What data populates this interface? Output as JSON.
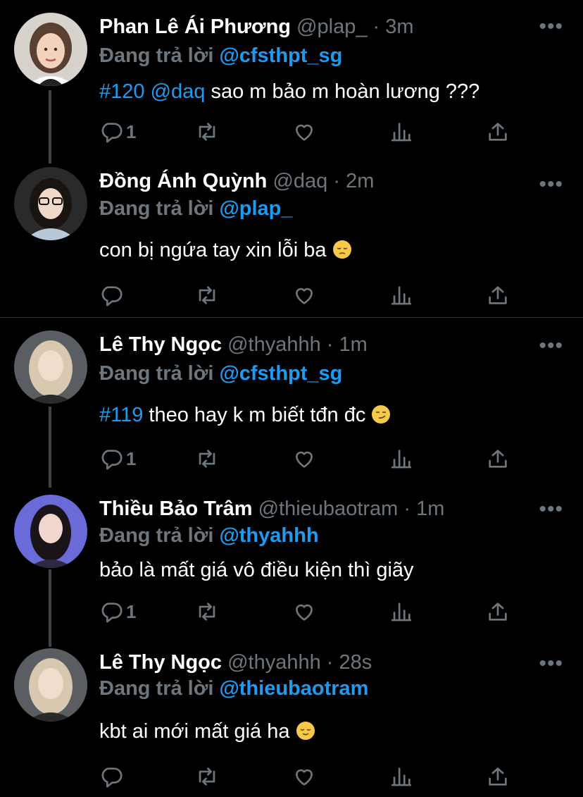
{
  "tweets": [
    {
      "name": "Phan Lê Ái Phương",
      "handle": "@plap_",
      "time": "3m",
      "reply_prefix": "Đang trả lời",
      "reply_to": "@cfsthpt_sg",
      "hashtag": "#120",
      "mention": "@daq",
      "text": " sao m bảo m hoàn lương ???",
      "reply_count": "1",
      "avatar_colors": {
        "bg": "#d8d2cc",
        "hair": "#5a4030",
        "skin": "#f2d2bd",
        "shirt": "#222222"
      }
    },
    {
      "name": "Đồng Ánh Quỳnh",
      "handle": "@daq",
      "time": "2m",
      "reply_prefix": "Đang trả lời",
      "reply_to": "@plap_",
      "text": "con bị ngứa tay xin lỗi ba",
      "emoji": "pensive-face",
      "reply_count": "",
      "avatar_colors": {
        "bg": "#2a2a2a",
        "hair": "#1a1410",
        "skin": "#f0d8c8",
        "shirt": "#b8c8d8"
      }
    },
    {
      "name": "Lê Thy Ngọc",
      "handle": "@thyahhh",
      "time": "1m",
      "reply_prefix": "Đang trả lời",
      "reply_to": "@cfsthpt_sg",
      "hashtag": "#119",
      "text": " theo hay k m biết tđn đc",
      "emoji": "smirking-face",
      "reply_count": "1",
      "avatar_colors": {
        "bg": "#5a5e62",
        "hair": "#d8c8b0",
        "skin": "#f2dccc",
        "shirt": "#2a2a2a"
      }
    },
    {
      "name": "Thiều Bảo Trâm",
      "handle": "@thieubaotram",
      "time": "1m",
      "reply_prefix": "Đang trả lời",
      "reply_to": "@thyahhh",
      "text": "bảo là mất giá vô điều kiện thì giãy",
      "reply_count": "1",
      "avatar_colors": {
        "bg": "#6a6ad8",
        "hair": "#1a1418",
        "skin": "#f0d8d0",
        "shirt": "#302840"
      }
    },
    {
      "name": "Lê Thy Ngọc",
      "handle": "@thyahhh",
      "time": "28s",
      "reply_prefix": "Đang trả lời",
      "reply_to": "@thieubaotram",
      "text": "kbt ai mới mất giá ha",
      "emoji": "relieved-face",
      "reply_count": "",
      "avatar_colors": {
        "bg": "#5a5e62",
        "hair": "#d8c8b0",
        "skin": "#f2dccc",
        "shirt": "#2a2a2a"
      }
    }
  ],
  "ui": {
    "more_label": "•••",
    "dot": " · "
  },
  "colors": {
    "background": "#000000",
    "muted": "#6e767d",
    "link": "#1d9bf0",
    "thread_line": "#3d4248",
    "separator": "#2f3336"
  }
}
